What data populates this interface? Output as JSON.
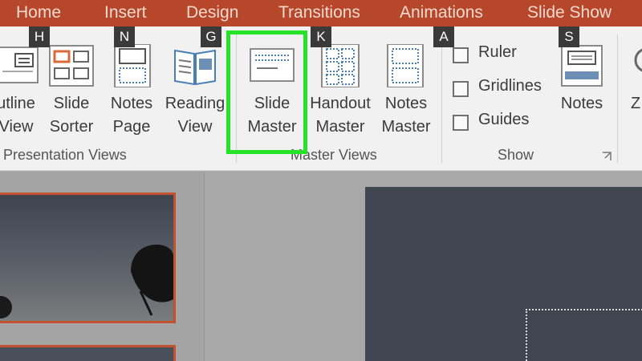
{
  "tabs": [
    "Home",
    "Insert",
    "Design",
    "Transitions",
    "Animations",
    "Slide Show"
  ],
  "keytips": [
    "H",
    "N",
    "G",
    "K",
    "A",
    "S"
  ],
  "presentation_views": {
    "outline_label": "utline\nView",
    "slide_sorter_label": "Slide\nSorter",
    "notes_page_label": "Notes\nPage",
    "reading_view_label": "Reading\nView",
    "group_label": "Presentation Views"
  },
  "master_views": {
    "slide_master_label": "Slide\nMaster",
    "handout_master_label": "Handout\nMaster",
    "notes_master_label": "Notes\nMaster",
    "group_label": "Master Views"
  },
  "show": {
    "ruler_label": "Ruler",
    "gridlines_label": "Gridlines",
    "guides_label": "Guides",
    "group_label": "Show",
    "ruler_checked": false,
    "gridlines_checked": false,
    "guides_checked": false
  },
  "notes_label": "Notes",
  "zoom_label": "Z",
  "colors": {
    "tab_bar": "#b7472a",
    "highlight": "#27e327",
    "thumbnail_border": "#c2522f"
  }
}
